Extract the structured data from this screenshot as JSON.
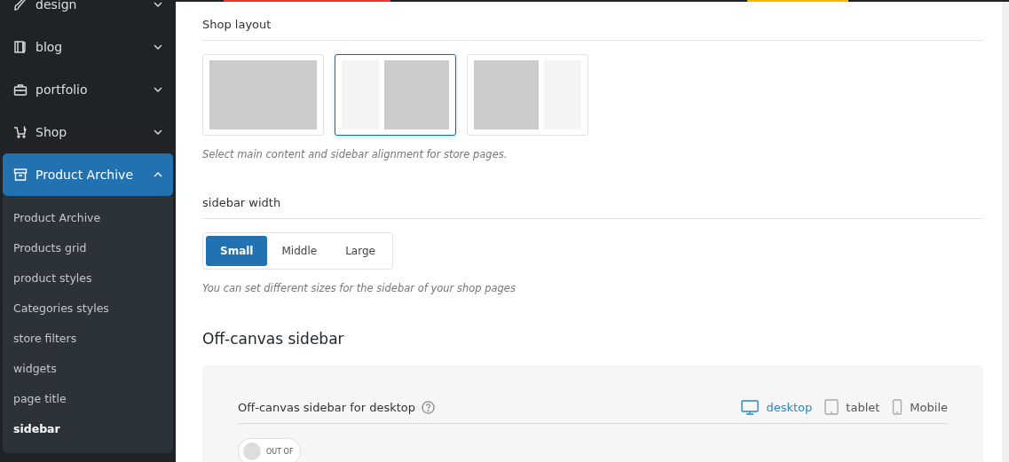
{
  "sidebar": {
    "items": [
      {
        "label": "design",
        "kind": "brush",
        "expanded": false,
        "selected": false
      },
      {
        "label": "blog",
        "kind": "book",
        "expanded": false,
        "selected": false
      },
      {
        "label": "portfolio",
        "kind": "briefcase",
        "expanded": false,
        "selected": false
      },
      {
        "label": "Shop",
        "kind": "cart",
        "expanded": false,
        "selected": false
      },
      {
        "label": "Product Archive",
        "kind": "archive",
        "expanded": true,
        "selected": true,
        "children": [
          {
            "label": "Product Archive",
            "selected": false
          },
          {
            "label": "Products grid",
            "selected": false
          },
          {
            "label": "product styles",
            "selected": false
          },
          {
            "label": "Categories styles",
            "selected": false
          },
          {
            "label": "store filters",
            "selected": false
          },
          {
            "label": "widgets",
            "selected": false
          },
          {
            "label": "page title",
            "selected": false
          },
          {
            "label": "sidebar",
            "selected": true
          }
        ]
      }
    ]
  },
  "shop_layout": {
    "title": "Shop layout",
    "options": [
      {
        "kind": "full",
        "selected": false
      },
      {
        "kind": "left",
        "selected": true
      },
      {
        "kind": "right",
        "selected": false
      }
    ],
    "hint": "Select main content and sidebar alignment for store pages."
  },
  "sidebar_width": {
    "title": "sidebar width",
    "options": [
      {
        "label": "Small",
        "selected": true
      },
      {
        "label": "Middle",
        "selected": false
      },
      {
        "label": "Large",
        "selected": false
      }
    ],
    "hint": "You can set different sizes for the sidebar of your shop pages"
  },
  "off_canvas": {
    "title": "Off-canvas sidebar",
    "setting": {
      "label": "Off-canvas sidebar for desktop",
      "devices": [
        {
          "label": "desktop",
          "kind": "desktop",
          "selected": true
        },
        {
          "label": "tablet",
          "kind": "tablet",
          "selected": false
        },
        {
          "label": "Mobile",
          "kind": "mobile",
          "selected": false
        }
      ],
      "toggle": {
        "label": "OUT OF",
        "on": false
      }
    }
  }
}
